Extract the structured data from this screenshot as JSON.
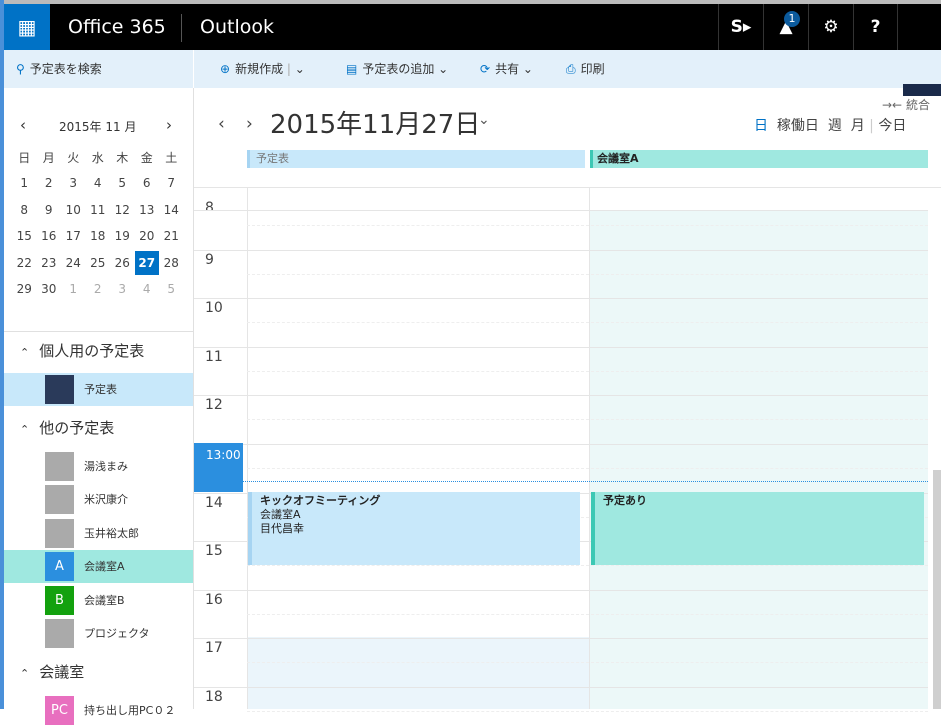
{
  "topbar": {
    "app_suite": "Office 365",
    "app_name": "Outlook",
    "notification_count": "1",
    "icons": [
      "app-launcher-icon",
      "sharepoint-icon",
      "bell-icon",
      "gear-icon",
      "help-icon"
    ]
  },
  "toolbar": {
    "search": "予定表を検索",
    "new": "新規作成",
    "add_calendar": "予定表の追加",
    "share": "共有",
    "print": "印刷"
  },
  "mini_calendar": {
    "title": "2015年 11 月",
    "weekdays": [
      "日",
      "月",
      "火",
      "水",
      "木",
      "金",
      "土"
    ],
    "weeks": [
      [
        "1",
        "2",
        "3",
        "4",
        "5",
        "6",
        "7"
      ],
      [
        "8",
        "9",
        "10",
        "11",
        "12",
        "13",
        "14"
      ],
      [
        "15",
        "16",
        "17",
        "18",
        "19",
        "20",
        "21"
      ],
      [
        "22",
        "23",
        "24",
        "25",
        "26",
        "27",
        "28"
      ],
      [
        "29",
        "30",
        "1",
        "2",
        "3",
        "4",
        "5"
      ]
    ],
    "selected": "27"
  },
  "sections": [
    {
      "title": "個人用の予定表",
      "items": [
        {
          "name": "予定表",
          "avatar": ""
        }
      ]
    },
    {
      "title": "他の予定表",
      "items": [
        {
          "name": "湯浅まみ",
          "avatar": ""
        },
        {
          "name": "米沢康介",
          "avatar": ""
        },
        {
          "name": "玉井裕太郎",
          "avatar": ""
        },
        {
          "name": "会議室A",
          "avatar": "A"
        },
        {
          "name": "会議室B",
          "avatar": "B"
        },
        {
          "name": "プロジェクタ",
          "avatar": ""
        }
      ]
    },
    {
      "title": "会議室",
      "items": [
        {
          "name": "持ち出し用PC０２",
          "avatar": "PC"
        }
      ]
    }
  ],
  "colors": {
    "accent": "#0072c6",
    "room_a": "#9fe8e0",
    "calendar": "#c8e8fa",
    "room_b": "#13a10e",
    "pc": "#e86fbf"
  },
  "main": {
    "date": "2015年11月27日",
    "merge": "統合",
    "views": [
      "日",
      "稼働日",
      "週",
      "月",
      "今日"
    ],
    "columns": [
      "予定表",
      "会議室A"
    ],
    "hours": [
      "8",
      "9",
      "10",
      "11",
      "12",
      "13:00",
      "14",
      "15",
      "16",
      "17",
      "18"
    ],
    "events": [
      {
        "title": "キックオフミーティング",
        "lines": [
          "会議室A",
          "目代昌幸"
        ]
      },
      {
        "title": "予定あり",
        "lines": []
      }
    ]
  }
}
